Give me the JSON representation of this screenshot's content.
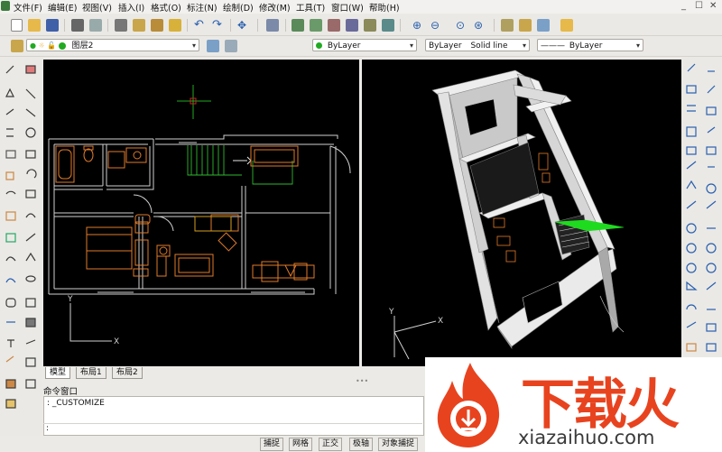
{
  "menu": {
    "items": [
      "文件(F)",
      "编辑(E)",
      "视图(V)",
      "插入(I)",
      "格式(O)",
      "标注(N)",
      "绘制(D)",
      "修改(M)",
      "工具(T)",
      "窗口(W)",
      "帮助(H)"
    ],
    "window_controls": [
      "_",
      "☐",
      "✕"
    ]
  },
  "layer_toolbar": {
    "current_layer": "图层2",
    "color": "ByLayer",
    "linetype_name": "ByLayer",
    "linetype_desc": "Solid line",
    "lineweight": "ByLayer"
  },
  "tabs": [
    "模型",
    "布局1",
    "布局2"
  ],
  "command": {
    "label": "命令窗口",
    "history": ": _CUSTOMIZE",
    "prompt": ":"
  },
  "status_buttons": [
    "捕捉",
    "网格",
    "正交",
    "极轴",
    "对象捕捉"
  ],
  "watermark": {
    "brand_cn": "下载火",
    "site": "xiazaihuo.com"
  },
  "colors": {
    "viewport_bg": "#000000",
    "wall": "#d8d8d8",
    "furniture": "#e07a2a",
    "crosshair": "#22aa22",
    "accent_green": "#1fdb1f",
    "brand_orange": "#e8431f"
  }
}
